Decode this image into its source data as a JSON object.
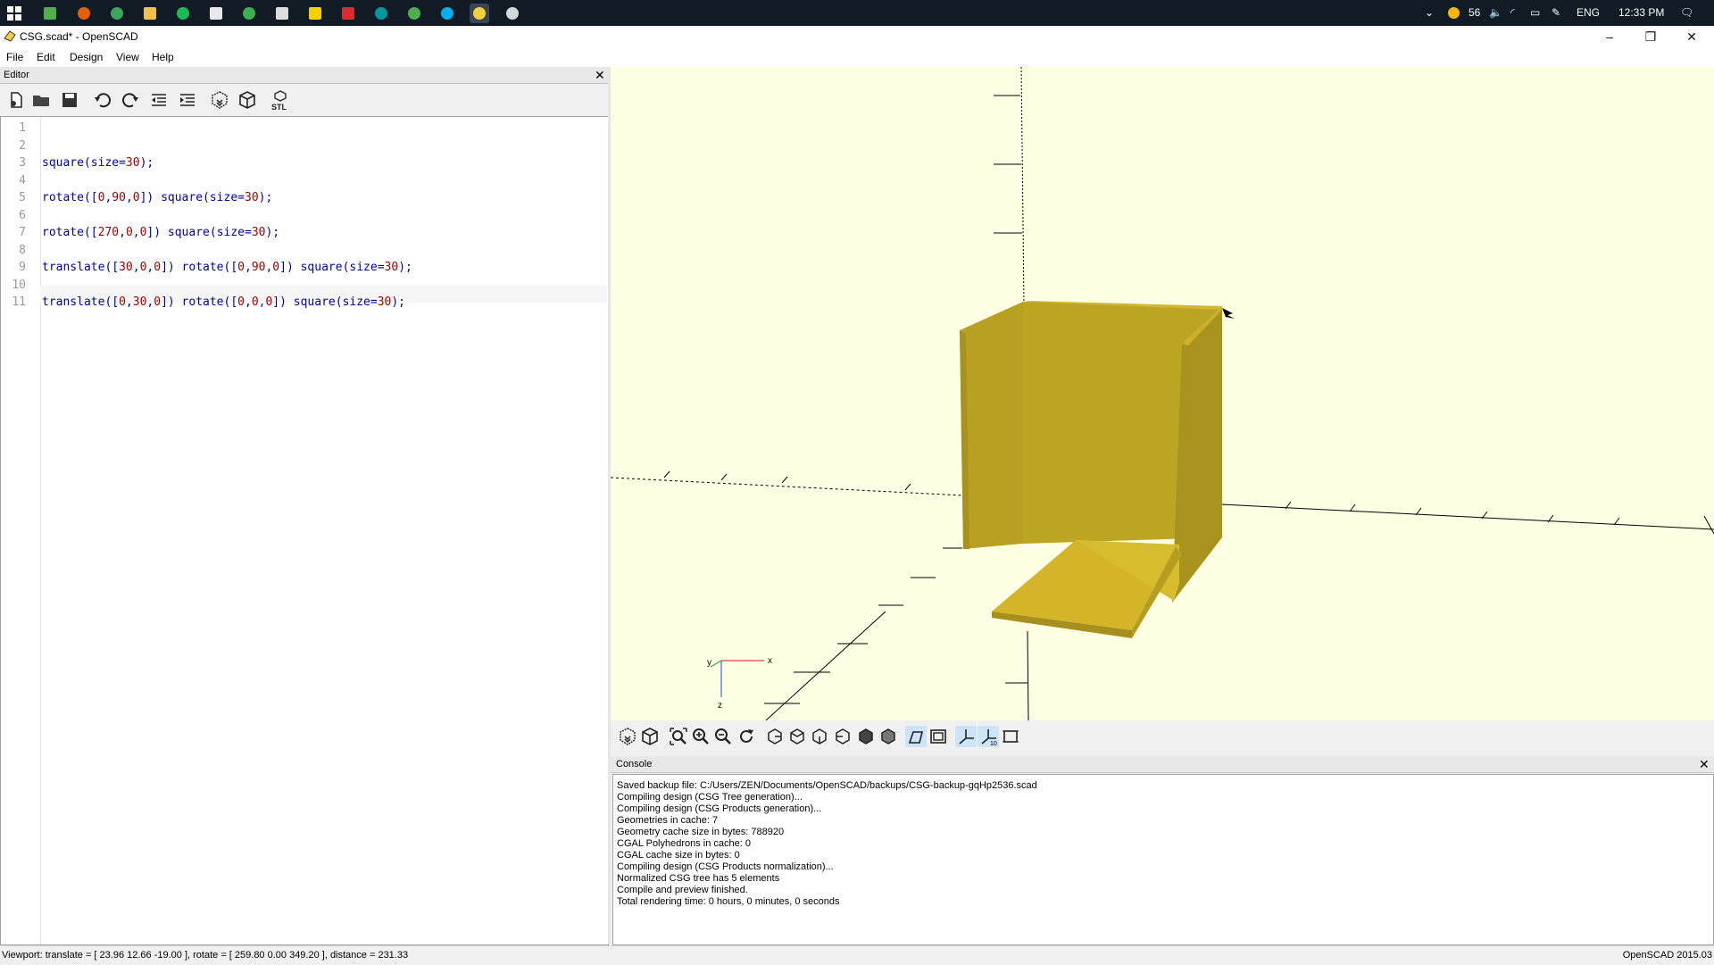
{
  "taskbar": {
    "tray_temp": "56",
    "tray_lang": "ENG",
    "tray_time": "12:33 PM"
  },
  "window": {
    "title": "CSG.scad* - OpenSCAD"
  },
  "menu": [
    "File",
    "Edit",
    "Design",
    "View",
    "Help"
  ],
  "editor": {
    "header": "Editor",
    "close": "✕",
    "line_numbers": [
      "1",
      "2",
      "3",
      "4",
      "5",
      "6",
      "7",
      "8",
      "9",
      "10",
      "11"
    ],
    "lines": [
      "",
      "",
      "square(size=30);",
      "",
      "rotate([0,90,0]) square(size=30);",
      "",
      "rotate([270,0,0]) square(size=30);",
      "",
      "translate([30,0,0]) rotate([0,90,0]) square(size=30);",
      "",
      "translate([0,30,0]) rotate([0,0,0]) square(size=30);"
    ],
    "toolbar_stl_label": "STL"
  },
  "viewport": {
    "background": "#ffffe4",
    "model_color": "#d4b52a",
    "axis_labels": {
      "x": "x",
      "y": "y",
      "z": "z"
    }
  },
  "console": {
    "header": "Console",
    "close": "✕",
    "lines": [
      "Saved backup file: C:/Users/ZEN/Documents/OpenSCAD/backups/CSG-backup-gqHp2536.scad",
      "Compiling design (CSG Tree generation)...",
      "Compiling design (CSG Products generation)...",
      "Geometries in cache: 7",
      "Geometry cache size in bytes: 788920",
      "CGAL Polyhedrons in cache: 0",
      "CGAL cache size in bytes: 0",
      "Compiling design (CSG Products normalization)...",
      "Normalized CSG tree has 5 elements",
      "Compile and preview finished.",
      "Total rendering time: 0 hours, 0 minutes, 0 seconds"
    ]
  },
  "status": {
    "left": "Viewport: translate = [ 23.96 12.66 -19.00 ], rotate = [ 259.80 0.00 349.20 ], distance = 231.33",
    "right": "OpenSCAD 2015.03"
  }
}
